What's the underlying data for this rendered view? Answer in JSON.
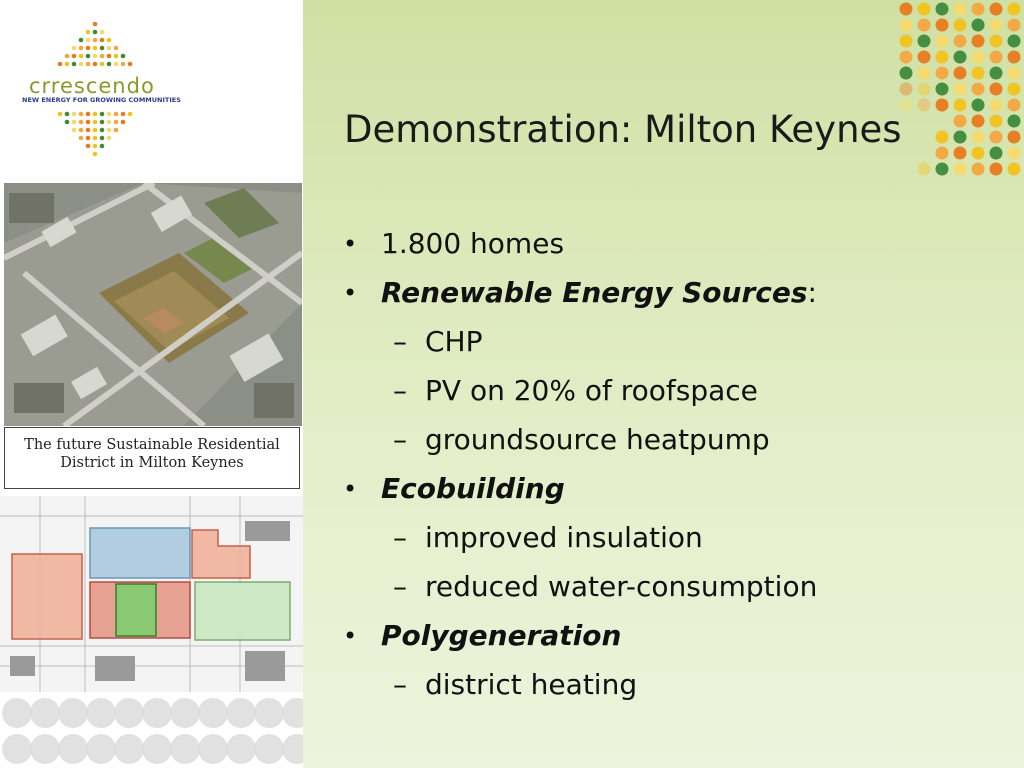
{
  "logo": {
    "name": "crrescendo",
    "tagline": "NEW ENERGY FOR GROWING COMMUNITIES"
  },
  "caption": {
    "line1": "The future Sustainable Residential",
    "line2": "District in Milton Keynes"
  },
  "slide": {
    "title": "Demonstration: Milton Keynes",
    "bullets": [
      {
        "text": "1.800 homes"
      },
      {
        "text": "Renewable Energy Sources",
        "suffix": ":"
      },
      {
        "text": "CHP"
      },
      {
        "text": "PV on 20% of roofspace"
      },
      {
        "text": "groundsource heatpump"
      },
      {
        "text": "Ecobuilding"
      },
      {
        "text": "improved insulation"
      },
      {
        "text": "reduced water-consumption"
      },
      {
        "text": "Polygeneration"
      },
      {
        "text": "district heating"
      }
    ],
    "bullet_glyph": "•",
    "dash_glyph": "–"
  },
  "colors": {
    "accent_orange": "#e87a1e",
    "accent_yellow": "#f2c21b",
    "accent_green": "#3c8a3a",
    "background_green": "#dbe8b8"
  }
}
